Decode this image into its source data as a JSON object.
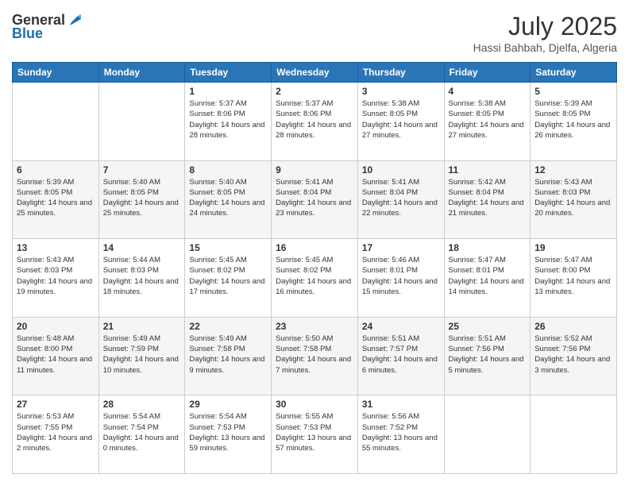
{
  "header": {
    "logo_line1": "General",
    "logo_line2": "Blue",
    "month_title": "July 2025",
    "location": "Hassi Bahbah, Djelfa, Algeria"
  },
  "weekdays": [
    "Sunday",
    "Monday",
    "Tuesday",
    "Wednesday",
    "Thursday",
    "Friday",
    "Saturday"
  ],
  "weeks": [
    [
      {
        "day": "",
        "info": ""
      },
      {
        "day": "",
        "info": ""
      },
      {
        "day": "1",
        "info": "Sunrise: 5:37 AM\nSunset: 8:06 PM\nDaylight: 14 hours and 28 minutes."
      },
      {
        "day": "2",
        "info": "Sunrise: 5:37 AM\nSunset: 8:06 PM\nDaylight: 14 hours and 28 minutes."
      },
      {
        "day": "3",
        "info": "Sunrise: 5:38 AM\nSunset: 8:05 PM\nDaylight: 14 hours and 27 minutes."
      },
      {
        "day": "4",
        "info": "Sunrise: 5:38 AM\nSunset: 8:05 PM\nDaylight: 14 hours and 27 minutes."
      },
      {
        "day": "5",
        "info": "Sunrise: 5:39 AM\nSunset: 8:05 PM\nDaylight: 14 hours and 26 minutes."
      }
    ],
    [
      {
        "day": "6",
        "info": "Sunrise: 5:39 AM\nSunset: 8:05 PM\nDaylight: 14 hours and 25 minutes."
      },
      {
        "day": "7",
        "info": "Sunrise: 5:40 AM\nSunset: 8:05 PM\nDaylight: 14 hours and 25 minutes."
      },
      {
        "day": "8",
        "info": "Sunrise: 5:40 AM\nSunset: 8:05 PM\nDaylight: 14 hours and 24 minutes."
      },
      {
        "day": "9",
        "info": "Sunrise: 5:41 AM\nSunset: 8:04 PM\nDaylight: 14 hours and 23 minutes."
      },
      {
        "day": "10",
        "info": "Sunrise: 5:41 AM\nSunset: 8:04 PM\nDaylight: 14 hours and 22 minutes."
      },
      {
        "day": "11",
        "info": "Sunrise: 5:42 AM\nSunset: 8:04 PM\nDaylight: 14 hours and 21 minutes."
      },
      {
        "day": "12",
        "info": "Sunrise: 5:43 AM\nSunset: 8:03 PM\nDaylight: 14 hours and 20 minutes."
      }
    ],
    [
      {
        "day": "13",
        "info": "Sunrise: 5:43 AM\nSunset: 8:03 PM\nDaylight: 14 hours and 19 minutes."
      },
      {
        "day": "14",
        "info": "Sunrise: 5:44 AM\nSunset: 8:03 PM\nDaylight: 14 hours and 18 minutes."
      },
      {
        "day": "15",
        "info": "Sunrise: 5:45 AM\nSunset: 8:02 PM\nDaylight: 14 hours and 17 minutes."
      },
      {
        "day": "16",
        "info": "Sunrise: 5:45 AM\nSunset: 8:02 PM\nDaylight: 14 hours and 16 minutes."
      },
      {
        "day": "17",
        "info": "Sunrise: 5:46 AM\nSunset: 8:01 PM\nDaylight: 14 hours and 15 minutes."
      },
      {
        "day": "18",
        "info": "Sunrise: 5:47 AM\nSunset: 8:01 PM\nDaylight: 14 hours and 14 minutes."
      },
      {
        "day": "19",
        "info": "Sunrise: 5:47 AM\nSunset: 8:00 PM\nDaylight: 14 hours and 13 minutes."
      }
    ],
    [
      {
        "day": "20",
        "info": "Sunrise: 5:48 AM\nSunset: 8:00 PM\nDaylight: 14 hours and 11 minutes."
      },
      {
        "day": "21",
        "info": "Sunrise: 5:49 AM\nSunset: 7:59 PM\nDaylight: 14 hours and 10 minutes."
      },
      {
        "day": "22",
        "info": "Sunrise: 5:49 AM\nSunset: 7:58 PM\nDaylight: 14 hours and 9 minutes."
      },
      {
        "day": "23",
        "info": "Sunrise: 5:50 AM\nSunset: 7:58 PM\nDaylight: 14 hours and 7 minutes."
      },
      {
        "day": "24",
        "info": "Sunrise: 5:51 AM\nSunset: 7:57 PM\nDaylight: 14 hours and 6 minutes."
      },
      {
        "day": "25",
        "info": "Sunrise: 5:51 AM\nSunset: 7:56 PM\nDaylight: 14 hours and 5 minutes."
      },
      {
        "day": "26",
        "info": "Sunrise: 5:52 AM\nSunset: 7:56 PM\nDaylight: 14 hours and 3 minutes."
      }
    ],
    [
      {
        "day": "27",
        "info": "Sunrise: 5:53 AM\nSunset: 7:55 PM\nDaylight: 14 hours and 2 minutes."
      },
      {
        "day": "28",
        "info": "Sunrise: 5:54 AM\nSunset: 7:54 PM\nDaylight: 14 hours and 0 minutes."
      },
      {
        "day": "29",
        "info": "Sunrise: 5:54 AM\nSunset: 7:53 PM\nDaylight: 13 hours and 59 minutes."
      },
      {
        "day": "30",
        "info": "Sunrise: 5:55 AM\nSunset: 7:53 PM\nDaylight: 13 hours and 57 minutes."
      },
      {
        "day": "31",
        "info": "Sunrise: 5:56 AM\nSunset: 7:52 PM\nDaylight: 13 hours and 55 minutes."
      },
      {
        "day": "",
        "info": ""
      },
      {
        "day": "",
        "info": ""
      }
    ]
  ]
}
